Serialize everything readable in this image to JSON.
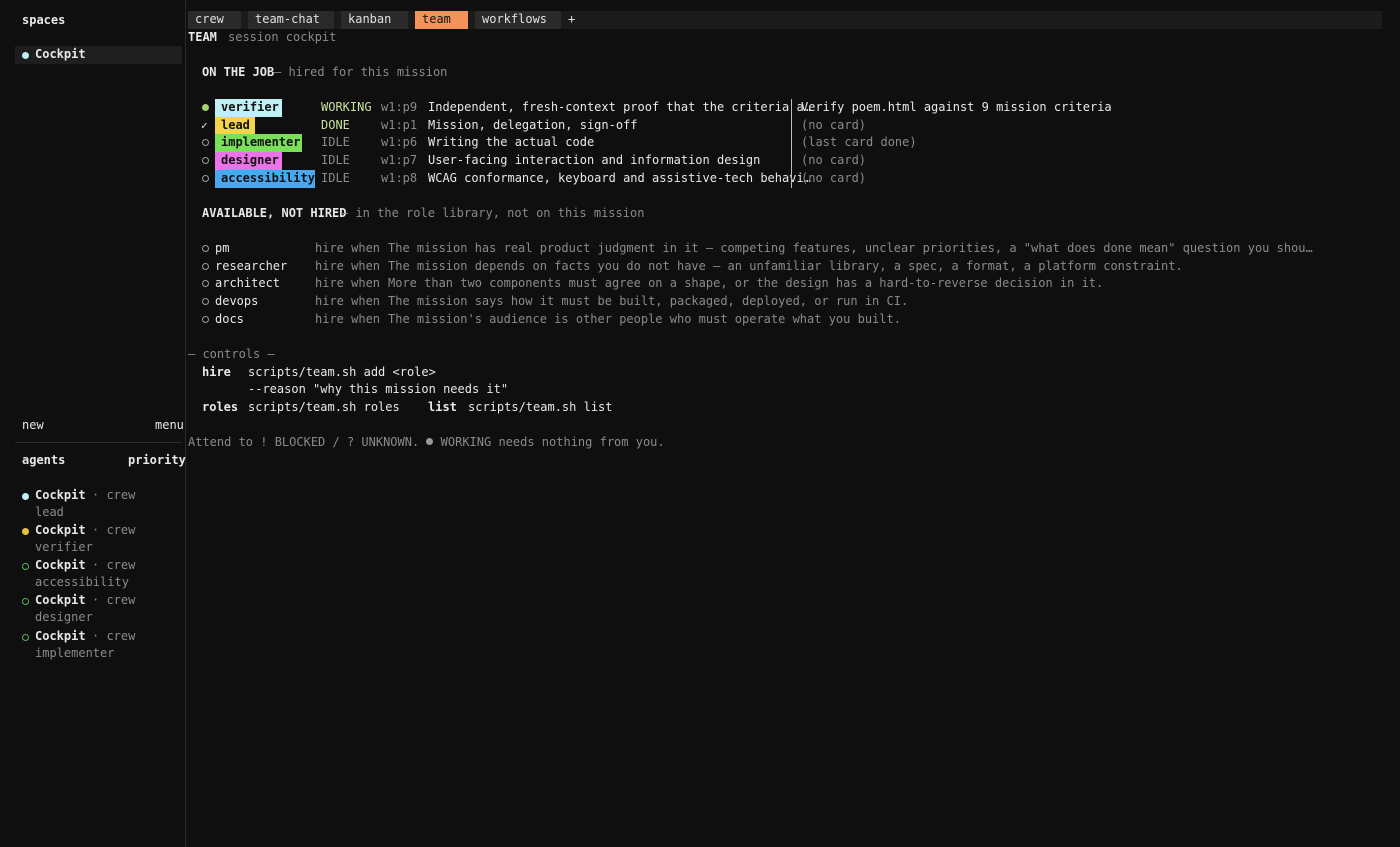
{
  "sidebar": {
    "title": "spaces",
    "space": {
      "label": "Cockpit",
      "dot_color": "#bff0f5"
    },
    "new_label": "new",
    "menu_label": "menu",
    "agents_header": "agents",
    "priority_header": "priority",
    "agents": [
      {
        "name": "Cockpit",
        "meta": "· crew",
        "role": "lead",
        "dot_color": "#bff0f5",
        "dot_style": "filled"
      },
      {
        "name": "Cockpit",
        "meta": "· crew",
        "role": "verifier",
        "dot_color": "#e8c13a",
        "dot_style": "filled"
      },
      {
        "name": "Cockpit",
        "meta": "· crew",
        "role": "accessibility",
        "dot_color": "#5bb05b",
        "dot_style": "hollow"
      },
      {
        "name": "Cockpit",
        "meta": "· crew",
        "role": "designer",
        "dot_color": "#5bb05b",
        "dot_style": "hollow"
      },
      {
        "name": "Cockpit",
        "meta": "· crew",
        "role": "implementer",
        "dot_color": "#5bb05b",
        "dot_style": "hollow"
      }
    ]
  },
  "tabs": [
    {
      "label": "crew",
      "active": false
    },
    {
      "label": "team-chat",
      "active": false
    },
    {
      "label": "kanban",
      "active": false
    },
    {
      "label": "team",
      "active": true
    },
    {
      "label": "workflows",
      "active": false
    }
  ],
  "tab_add_label": "+",
  "header": {
    "title": "TEAM",
    "subtitle": "session cockpit"
  },
  "on_the_job": {
    "heading": "ON THE JOB",
    "subheading": "— hired for this mission",
    "rows": [
      {
        "marker": "dot",
        "marker_color": "#a4d36b",
        "role": "verifier",
        "badge_color": "#bff0f5",
        "status": "WORKING",
        "status_color": "#c8e39a",
        "pane": "w1:p9",
        "desc": "Independent, fresh-context proof that the criteria a…",
        "card": "Verify poem.html against 9 mission criteria"
      },
      {
        "marker": "check",
        "marker_color": "#e8e8e8",
        "role": "lead",
        "badge_color": "#f5d34a",
        "status": "DONE",
        "status_color": "#c8e39a",
        "pane": "w1:p1",
        "desc": "Mission, delegation, sign-off",
        "card": "(no card)"
      },
      {
        "marker": "hollow",
        "marker_color": "#9a9a9a",
        "role": "implementer",
        "badge_color": "#7ae05a",
        "status": "IDLE",
        "status_color": "#8a8a8a",
        "pane": "w1:p6",
        "desc": "Writing the actual code",
        "card": "(last card done)"
      },
      {
        "marker": "hollow",
        "marker_color": "#9a9a9a",
        "role": "designer",
        "badge_color": "#ec72ea",
        "status": "IDLE",
        "status_color": "#8a8a8a",
        "pane": "w1:p7",
        "desc": "User-facing interaction and information design",
        "card": "(no card)"
      },
      {
        "marker": "hollow",
        "marker_color": "#9a9a9a",
        "role": "accessibility",
        "badge_color": "#4aa8f0",
        "status": "IDLE",
        "status_color": "#8a8a8a",
        "pane": "w1:p8",
        "desc": "WCAG conformance, keyboard and assistive-tech behavi…",
        "card": "(no card)"
      }
    ]
  },
  "available": {
    "heading": "AVAILABLE, NOT HIRED",
    "subheading": "— in the role library, not on this mission",
    "hire_when_label": "hire when",
    "rows": [
      {
        "role": "pm",
        "desc": "The mission has real product judgment in it — competing features, unclear priorities, a \"what does done mean\" question you shou…"
      },
      {
        "role": "researcher",
        "desc": "The mission depends on facts you do not have — an unfamiliar library, a spec, a format, a platform constraint."
      },
      {
        "role": "architect",
        "desc": "More than two components must agree on a shape, or the design has a hard-to-reverse decision in it."
      },
      {
        "role": "devops",
        "desc": "The mission says how it must be built, packaged, deployed, or run in CI."
      },
      {
        "role": "docs",
        "desc": "The mission's audience is other people who must operate what you built."
      }
    ]
  },
  "controls": {
    "heading": "— controls —",
    "hire_label": "hire",
    "hire_cmd": "scripts/team.sh add <role>",
    "hire_cmd2": "--reason \"why this mission needs it\"",
    "roles_label": "roles",
    "roles_cmd": "scripts/team.sh roles",
    "list_label": "list",
    "list_cmd": "scripts/team.sh list"
  },
  "footer": {
    "text_before": "Attend to ! BLOCKED / ? UNKNOWN.",
    "text_after": "WORKING needs nothing from you."
  }
}
